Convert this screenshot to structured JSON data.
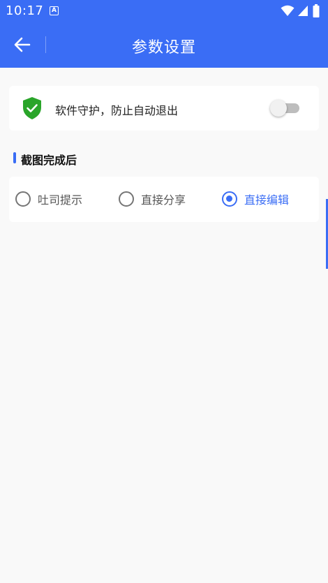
{
  "status_bar": {
    "time": "10:17",
    "app_icon_letter": "A",
    "icons": [
      "wifi-icon",
      "signal-icon",
      "battery-icon"
    ]
  },
  "app_bar": {
    "back_icon": "arrow-left-icon",
    "title": "参数设置"
  },
  "guard": {
    "icon": "shield-check-icon",
    "label": "软件守护，防止自动退出",
    "enabled": false
  },
  "screenshot_section": {
    "title": "截图完成后",
    "options": [
      {
        "label": "吐司提示",
        "selected": false
      },
      {
        "label": "直接分享",
        "selected": false
      },
      {
        "label": "直接编辑",
        "selected": true
      }
    ]
  },
  "colors": {
    "primary": "#3a6df5",
    "shield": "#2aa52a",
    "background": "#f9f9f9"
  }
}
